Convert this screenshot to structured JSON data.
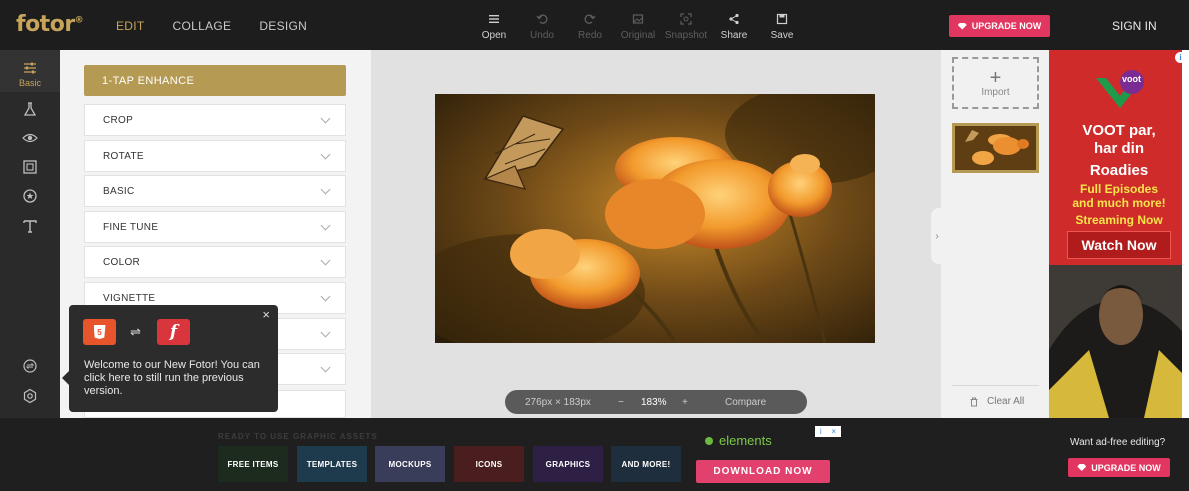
{
  "app": {
    "logo": "fotor",
    "logo_mark": "®"
  },
  "nav": {
    "edit": "EDIT",
    "collage": "COLLAGE",
    "design": "DESIGN"
  },
  "toolbar": {
    "open": "Open",
    "undo": "Undo",
    "redo": "Redo",
    "original": "Original",
    "snapshot": "Snapshot",
    "share": "Share",
    "save": "Save"
  },
  "header": {
    "upgrade": "UPGRADE NOW",
    "signin": "SIGN IN"
  },
  "rail": {
    "basic": "Basic"
  },
  "panel": {
    "enhance": "1-TAP ENHANCE",
    "items": [
      "CROP",
      "ROTATE",
      "BASIC",
      "FINE TUNE",
      "COLOR",
      "VIGNETTE"
    ]
  },
  "popup": {
    "close": "×",
    "html5_badge": "5",
    "swap": "⇌",
    "flash_badge": "f",
    "message": "Welcome to our New Fotor! You can click here to still run the previous version."
  },
  "canvas": {
    "dimensions": "276px × 183px",
    "zoom_minus": "−",
    "zoom": "183%",
    "zoom_plus": "+",
    "compare": "Compare"
  },
  "strip": {
    "import": "Import",
    "clear_all": "Clear All",
    "handle": "›"
  },
  "ad_right": {
    "brand": "voot",
    "headline_1": "VOOT par,",
    "headline_2": "har din",
    "headline_3": "Roadies",
    "sub_1": "Full Episodes",
    "sub_2": "and much more!",
    "sub_3": "Streaming Now",
    "cta": "Watch Now",
    "info": "i"
  },
  "ad_bottom": {
    "ready": "READY TO USE GRAPHIC ASSETS",
    "assets": [
      "FREE ITEMS",
      "TEMPLATES",
      "MOCKUPS",
      "ICONS",
      "GRAPHICS",
      "AND MORE!"
    ],
    "brand": "elements",
    "download": "DOWNLOAD NOW",
    "adchoice_info": "i",
    "adchoice_close": "×",
    "want": "Want ad-free editing?",
    "upgrade": "UPGRADE NOW"
  },
  "colors": {
    "gold": "#b49a52",
    "pink": "#e0365f",
    "dark": "#1d1d1d"
  }
}
